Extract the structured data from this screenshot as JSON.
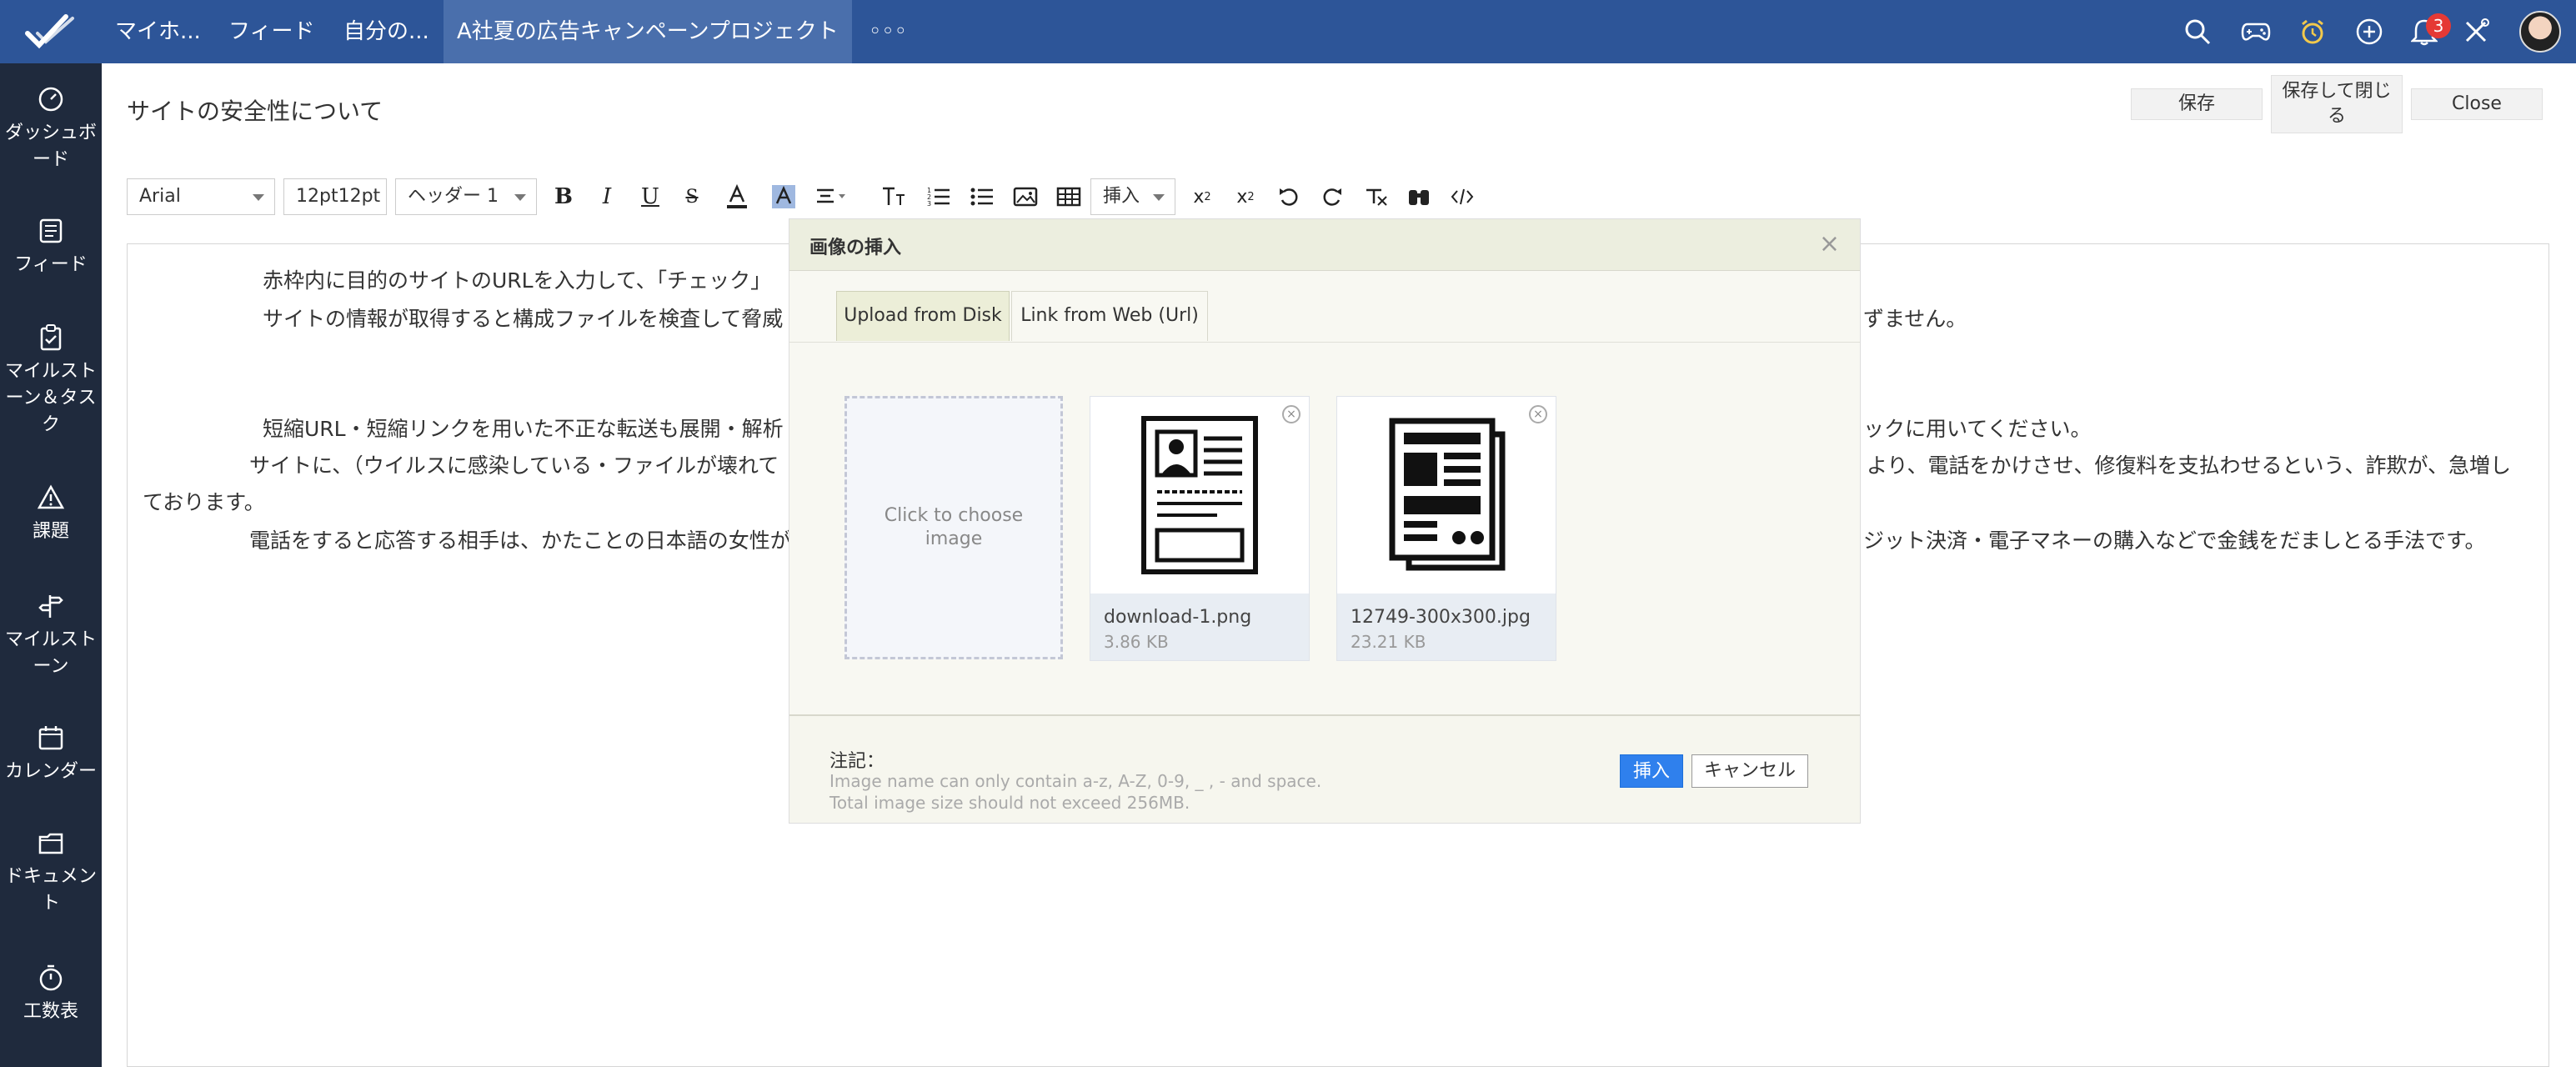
{
  "topbar": {
    "nav": [
      "マイホ...",
      "フィード",
      "自分の...",
      "A社夏の広告キャンペーンプロジェクト",
      "◦◦◦"
    ],
    "notification_count": "3",
    "colors": {
      "bar": "#2d5598",
      "active_tab": "#4a6fac"
    },
    "icons": [
      "search-icon",
      "gamepad-icon",
      "alarm-clock-icon",
      "add-circle-icon",
      "bell-icon",
      "tools-icon",
      "avatar"
    ]
  },
  "sidebar": {
    "items": [
      {
        "label": "ダッシュボード",
        "icon": "dashboard-icon"
      },
      {
        "label": "フィード",
        "icon": "feed-icon"
      },
      {
        "label": "マイルストーン＆タスク",
        "icon": "clipboard-icon"
      },
      {
        "label": "課題",
        "icon": "warning-icon"
      },
      {
        "label": "マイルストーン",
        "icon": "signpost-icon"
      },
      {
        "label": "カレンダー",
        "icon": "calendar-icon"
      },
      {
        "label": "ドキュメント",
        "icon": "folder-icon"
      },
      {
        "label": "工数表",
        "icon": "timer-icon"
      }
    ]
  },
  "page": {
    "title": "サイトの安全性について",
    "save": "保存",
    "save_close": "保存して閉じる",
    "close": "Close"
  },
  "toolbar": {
    "font": "Arial",
    "size": "12pt12pt",
    "heading": "ヘッダー 1",
    "insert": "挿入",
    "icons": [
      "bold-icon",
      "italic-icon",
      "underline-icon",
      "strikethrough-icon",
      "font-color-icon",
      "highlight-icon",
      "align-icon",
      "text-size-icon",
      "ordered-list-icon",
      "bullet-list-icon",
      "image-icon",
      "table-icon",
      "subscript-icon",
      "superscript-icon",
      "undo-icon",
      "redo-icon",
      "clear-format-icon",
      "find-icon",
      "code-icon"
    ]
  },
  "editor": {
    "lines": [
      "赤枠内に目的のサイトのURLを入力して、「チェック」",
      "サイトの情報が取得すると構成ファイルを検査して脅威",
      "ずません。",
      "短縮URL・短縮リンクを用いた不正な転送も展開・解析",
      "ックに用いてください。",
      "サイトに、（ウイルスに感染している・ファイルが壊れて",
      "より、電話をかけさせ、修復料を支払わせるという、詐欺が、急増し",
      "ております。",
      "電話をすると応答する相手は、かたことの日本語の女性が",
      "ジット決済・電子マネーの購入などで金銭をだましとる手法です。"
    ]
  },
  "dialog": {
    "title": "画像の挿入",
    "tab_upload": "Upload from Disk",
    "tab_link": "Link from Web (Url)",
    "dropzone": "Click to choose image",
    "files": [
      {
        "name": "download-1.png",
        "size": "3.86 KB"
      },
      {
        "name": "12749-300x300.jpg",
        "size": "23.21 KB"
      }
    ],
    "note_label": "注記：",
    "note_1": "Image name can only contain a-z, A-Z, 0-9, _ , - and space.",
    "note_2": "Total image size should not exceed 256MB.",
    "insert": "挿入",
    "cancel": "キャンセル"
  }
}
